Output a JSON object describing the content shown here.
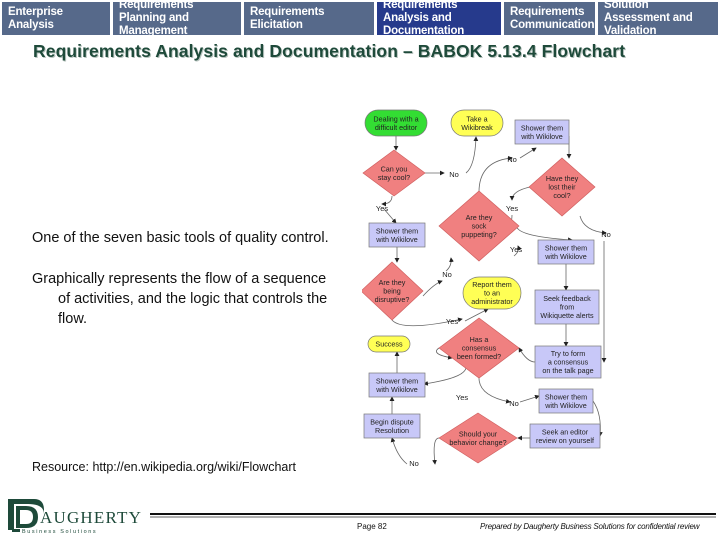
{
  "nav": {
    "tabs": [
      {
        "label": "Enterprise Analysis",
        "active": false
      },
      {
        "label": "Requirements Planning and Management",
        "active": false
      },
      {
        "label": "Requirements Elicitation",
        "active": false
      },
      {
        "label": "Requirements Analysis and Documentation",
        "active": true
      },
      {
        "label": "Requirements Communication",
        "active": false
      },
      {
        "label": "Solution Assessment and Validation",
        "active": false
      }
    ]
  },
  "title": "Requirements Analysis and Documentation – BABOK 5.13.4 Flowchart",
  "bullets": [
    "One of the seven basic tools of quality control.",
    "Graphically represents the flow of a sequence of activities, and the logic that controls the flow."
  ],
  "resource": "Resource: http://en.wikipedia.org/wiki/Flowchart",
  "flowchart": {
    "colors": {
      "start": "#33dd33",
      "terminal": "#ffff55",
      "process": "#c8c8f8",
      "decision": "#f08080"
    },
    "nodes": {
      "dealing": "Dealing with a|difficult editor",
      "wikibreak": "Take a|Wikibreak",
      "shower1": "Shower them|with Wikilove",
      "stay_cool": "Can you|stay cool?",
      "lost_cool": "Have they|lost their|cool?",
      "sock": "Are they|sock|puppeting?",
      "shower2": "Shower them|with Wikilove",
      "shower3": "Shower them|with Wikilove",
      "disruptive": "Are they|being|disruptive?",
      "report": "Report them|to an|administrator",
      "feedback": "Seek feedback|from|Wikiquette alerts",
      "success": "Success",
      "consensus_q": "Has a|consensus|been formed?",
      "form_consensus": "Try to form|a consensus|on the talk page",
      "shower4": "Shower them|with Wikilove",
      "shower5": "Shower them|with Wikilove",
      "dispute": "Begin dispute|Resolution",
      "behavior": "Should your|behavior change?",
      "editor_review": "Seek an editor|review on yourself"
    },
    "labels": {
      "yes": "Yes",
      "no": "No"
    }
  },
  "logo": {
    "name": "DAUGHERTY",
    "tagline": "Business Solutions"
  },
  "footer": {
    "page": "Page 82",
    "prepared": "Prepared by Daugherty Business Solutions for confidential review"
  }
}
